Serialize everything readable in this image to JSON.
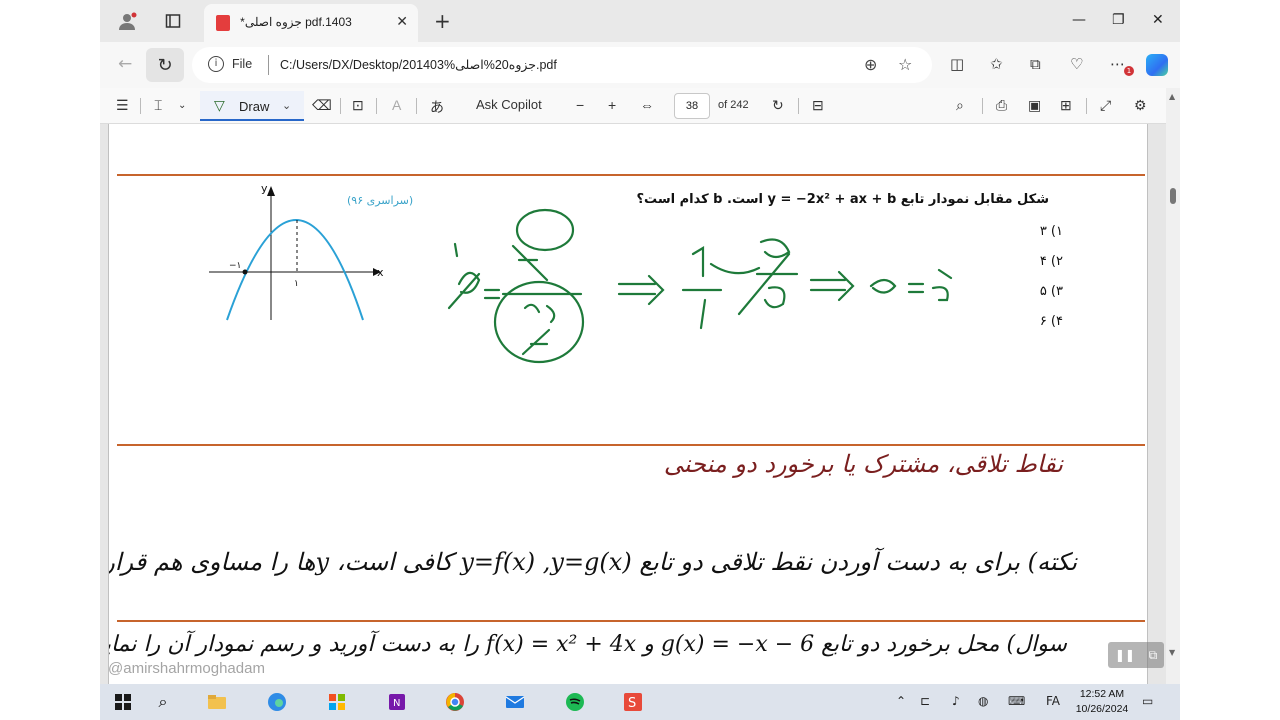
{
  "browser": {
    "tab_title": "*جزوه اصلی pdf.1403",
    "url_scheme_label": "File",
    "url": "C:/Users/DX/Desktop/201403%جزوه20%اصلی.pdf"
  },
  "pdf_toolbar": {
    "draw_label": "Draw",
    "ask_copilot": "Ask Copilot",
    "page_number": "38",
    "page_total": "of 242"
  },
  "document": {
    "question": "شکل مقابل نمودار تابع y = −2x² + ax + b است. b کدام است؟",
    "options": [
      "۱) ۳",
      "۲) ۴",
      "۳) ۵",
      "۴) ۶"
    ],
    "source_tag": "(سراسری ۹۶)",
    "graph_labels": {
      "y": "y",
      "x": "x",
      "neg_one": "−۱",
      "one": "۱"
    },
    "handwritten": {
      "step1": "a = (a/4)/(2a/-2)",
      "step2": "⟹ 1/1 = a/4",
      "step3": "⟹ a = 4"
    },
    "section_heading": "نقاط تلاقی، مشترک یا برخورد دو منحنی",
    "note": "نکته) برای به دست آوردن نقط تلاقی دو تابع y=f(x) ,y=g(x) کافی است، yها را مساوی هم قرار دهیم.",
    "question2": "سوال) محل برخورد دو تابع g(x) = −x − 6 و f(x) = x² + 4x را به دست آورید و رسم نمودار آن را نمایش"
  },
  "watermark": "@amirshahrmoghadam",
  "taskbar": {
    "time": "12:52 AM",
    "date": "10/26/2024",
    "lang": "FA"
  },
  "colors": {
    "divider": "#c7642c",
    "ink_green": "#1e7a3a",
    "heading_red": "#7a1f1f",
    "graph_blue": "#2aa1d6"
  }
}
